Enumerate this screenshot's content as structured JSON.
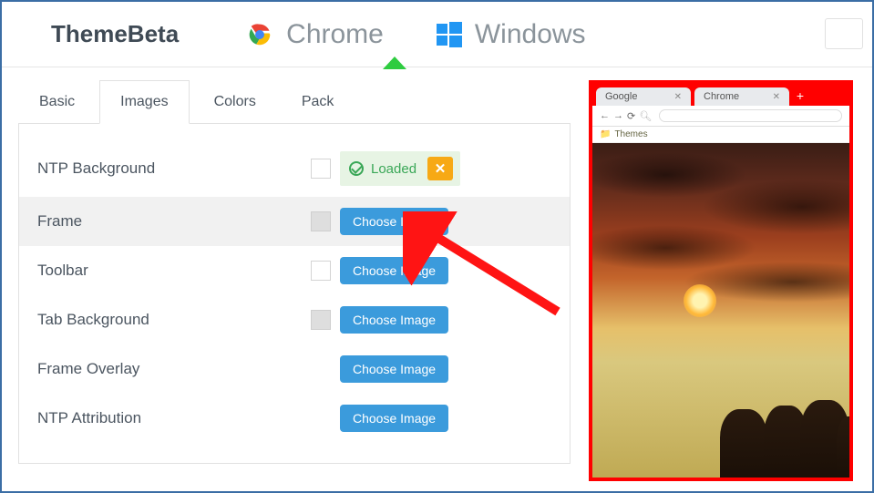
{
  "header": {
    "brand": "ThemeBeta",
    "nav": {
      "chrome": "Chrome",
      "windows": "Windows"
    }
  },
  "tabs": {
    "basic": "Basic",
    "images": "Images",
    "colors": "Colors",
    "pack": "Pack"
  },
  "rows": {
    "ntp_bg": {
      "label": "NTP Background",
      "loaded": "Loaded"
    },
    "frame": {
      "label": "Frame",
      "btn": "Choose Image"
    },
    "toolbar": {
      "label": "Toolbar",
      "btn": "Choose Image"
    },
    "tab_bg": {
      "label": "Tab Background",
      "btn": "Choose Image"
    },
    "frame_overlay": {
      "label": "Frame Overlay",
      "btn": "Choose Image"
    },
    "ntp_attr": {
      "label": "NTP Attribution",
      "btn": "Choose Image"
    }
  },
  "preview": {
    "tab1": "Google",
    "tab2": "Chrome",
    "bookmark": "Themes"
  }
}
